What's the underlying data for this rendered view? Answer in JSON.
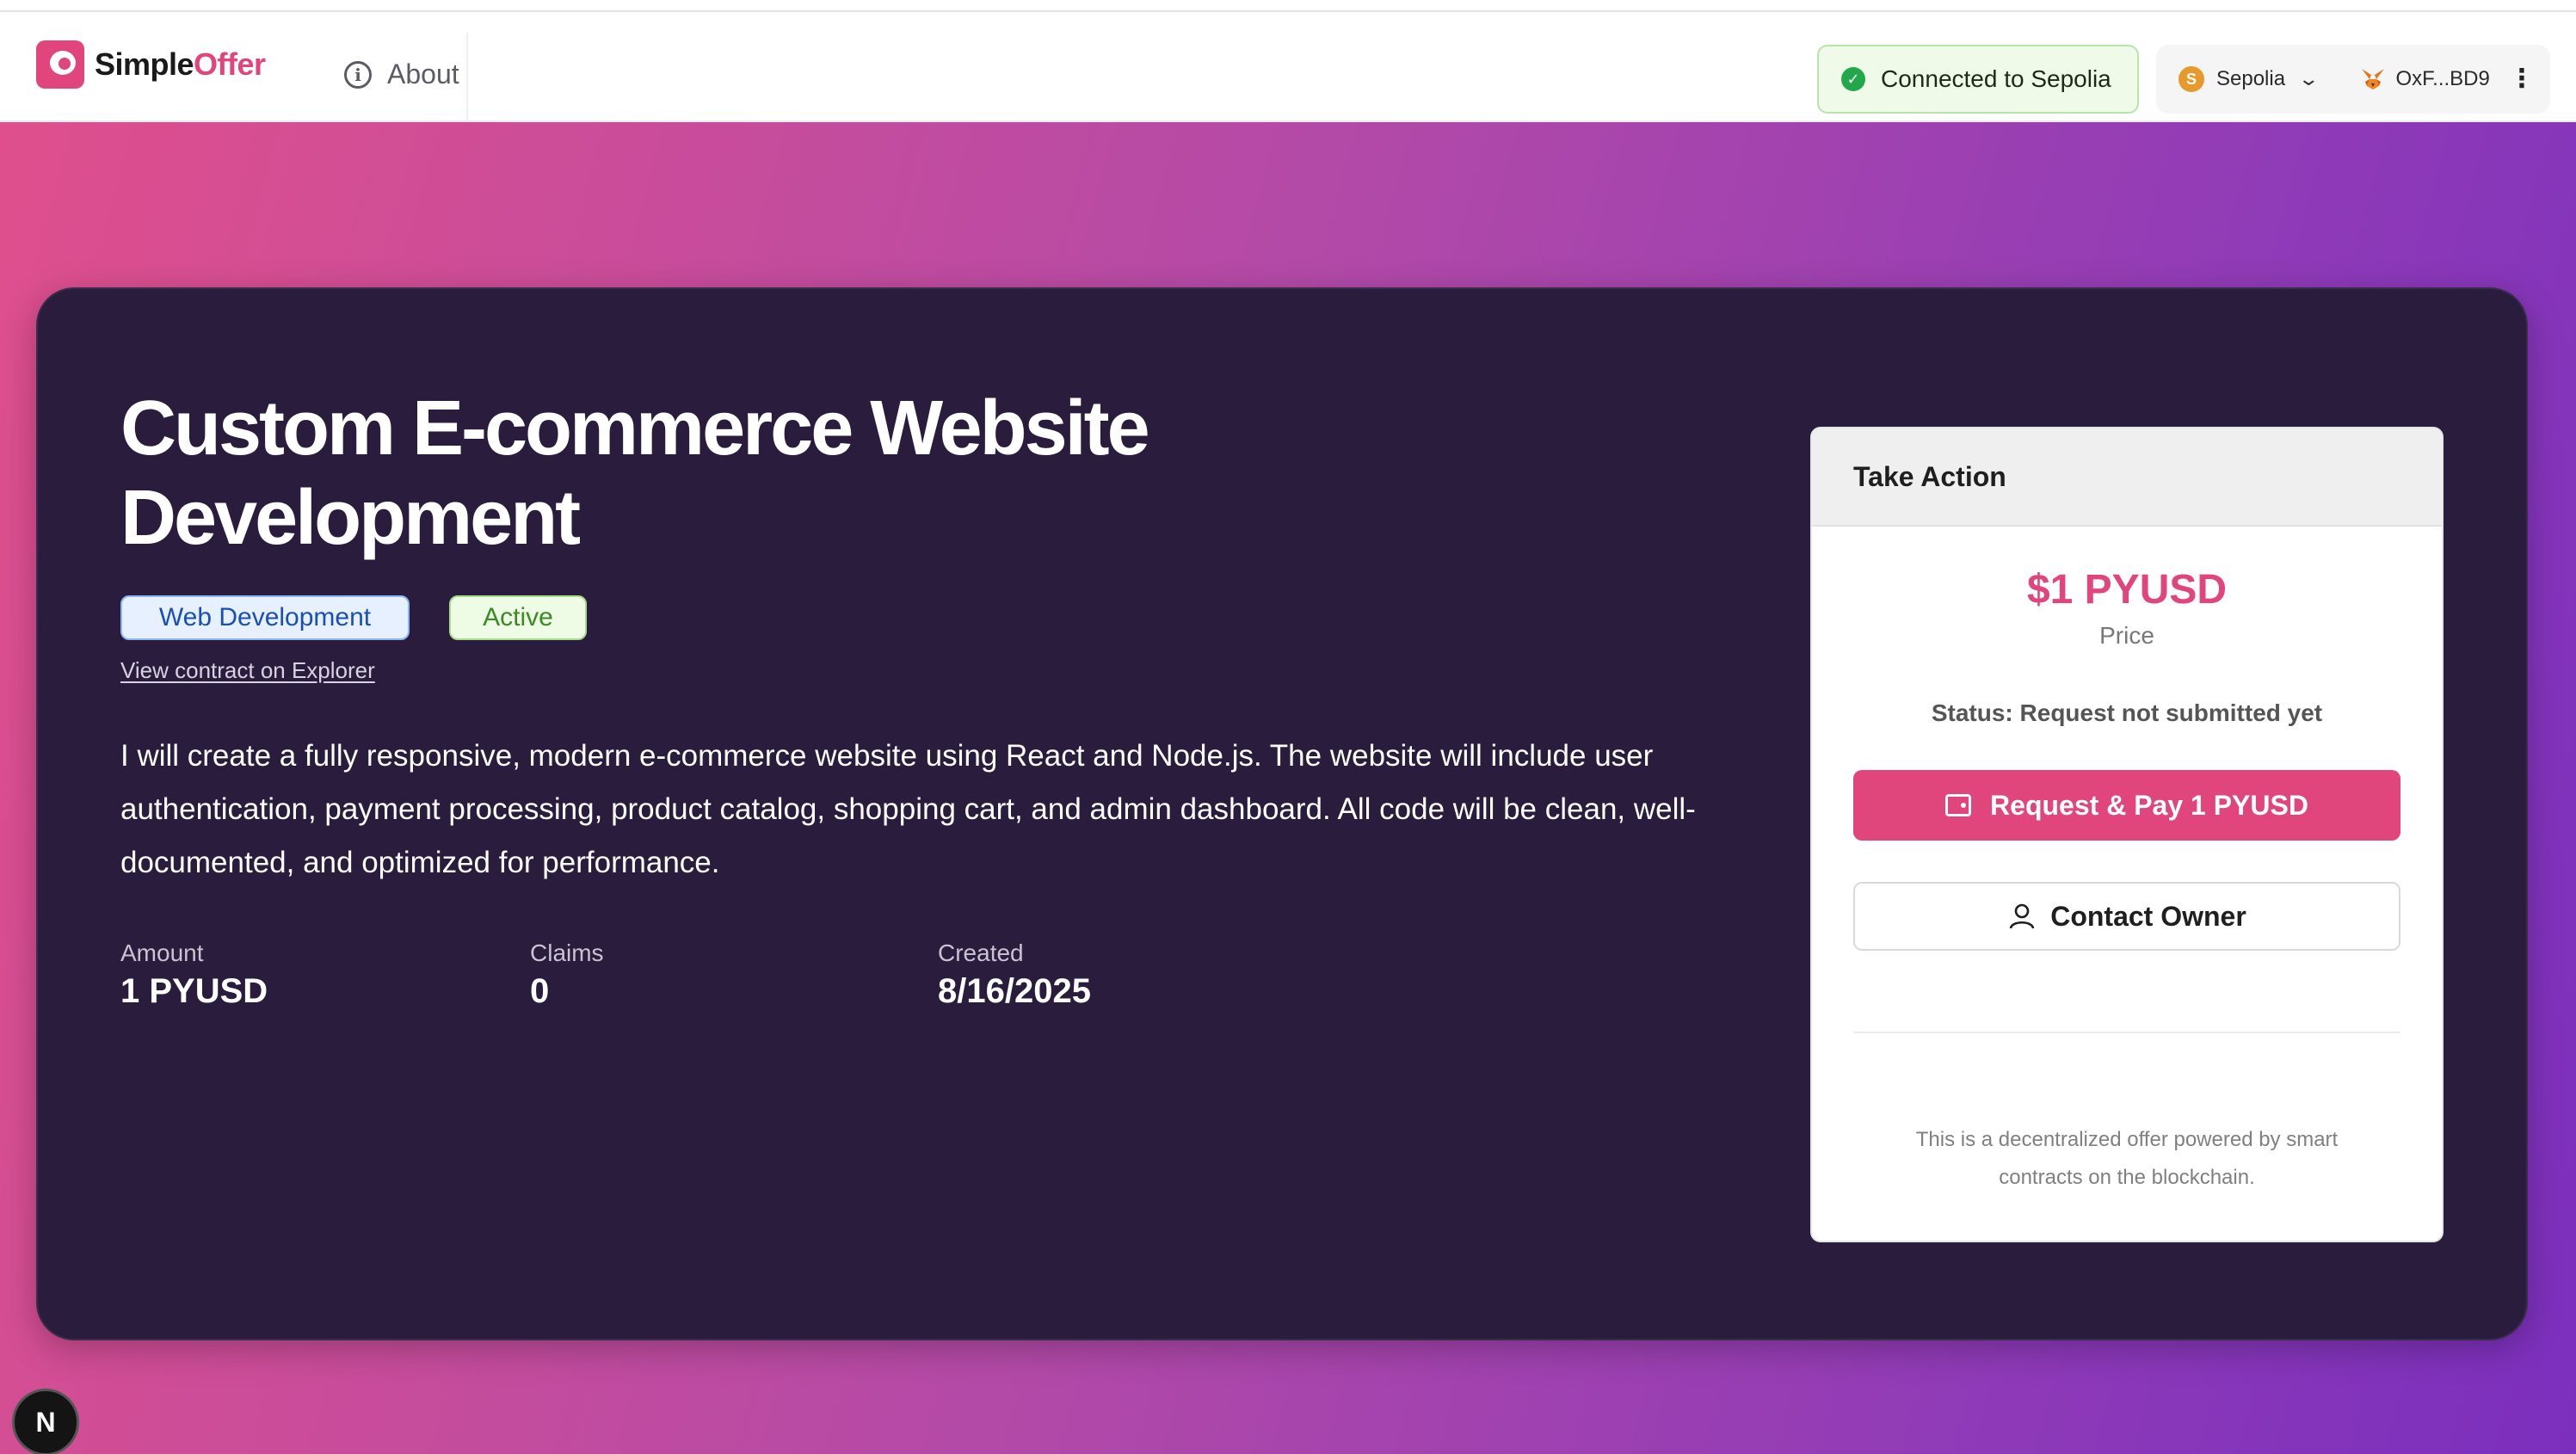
{
  "header": {
    "logo_text_primary": "Simple",
    "logo_text_accent": "Offer",
    "about_label": "About",
    "connection_status": "Connected to Sepolia",
    "network_letter": "S",
    "network_name": "Sepolia",
    "account_address": "OxF...BD9"
  },
  "offer": {
    "title": "Custom E-commerce Website Development",
    "category": "Web Development",
    "status_badge": "Active",
    "explorer_link": "View contract on Explorer",
    "description": "I will create a fully responsive, modern e-commerce website using React and Node.js. The website will include user authentication, payment processing, product catalog, shopping cart, and admin dashboard. All code will be clean, well-documented, and optimized for performance.",
    "stats": [
      {
        "label": "Amount",
        "value": "1 PYUSD"
      },
      {
        "label": "Claims",
        "value": "0"
      },
      {
        "label": "Created",
        "value": "8/16/2025"
      }
    ]
  },
  "action_panel": {
    "heading": "Take Action",
    "price": "$1 PYUSD",
    "price_label": "Price",
    "status_text": "Status: Request not submitted yet",
    "pay_button_label": "Request & Pay 1 PYUSD",
    "contact_button_label": "Contact Owner",
    "footnote": "This is a decentralized offer powered by smart contracts on the blockchain."
  },
  "dev_badge": {
    "label": "N"
  },
  "colors": {
    "accent": "#e0457b",
    "card_bg": "#2a1c3d",
    "success": "#22a84a"
  }
}
